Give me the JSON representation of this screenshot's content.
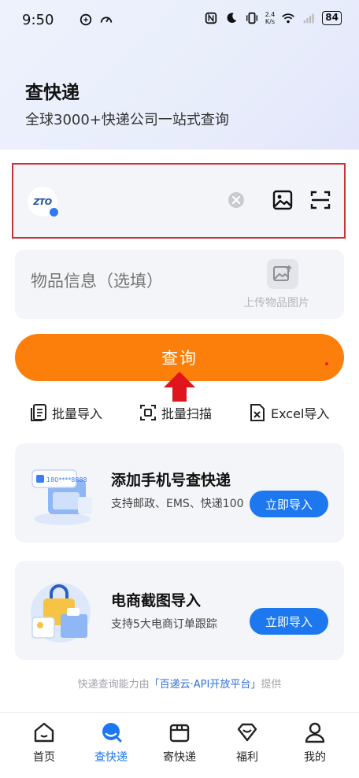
{
  "status_bar": {
    "time": "9:50",
    "net_speed_top": "2.4",
    "net_speed_bottom": "K/s",
    "battery": "84"
  },
  "header": {
    "title": "查快递",
    "subtitle": "全球3000+快递公司一站式查询"
  },
  "tracking": {
    "carrier_logo_text": "ZTO"
  },
  "item_info": {
    "placeholder": "物品信息（选填）",
    "upload_label": "上传物品图片"
  },
  "query_button": {
    "label": "查询"
  },
  "actions": [
    {
      "label": "批量导入"
    },
    {
      "label": "批量扫描"
    },
    {
      "label": "Excel导入"
    }
  ],
  "cards": [
    {
      "title": "添加手机号查快递",
      "desc": "支持邮政、EMS、快递100",
      "button": "立即导入",
      "illus_text": "180****8888"
    },
    {
      "title": "电商截图导入",
      "desc": "支持5大电商订单跟踪",
      "button": "立即导入"
    }
  ],
  "footer": {
    "prefix": "快递查询能力由",
    "highlight": "「百递云·API开放平台」",
    "suffix": "提供"
  },
  "tabs": [
    {
      "label": "首页",
      "active": false
    },
    {
      "label": "查快递",
      "active": true
    },
    {
      "label": "寄快递",
      "active": false
    },
    {
      "label": "福利",
      "active": false
    },
    {
      "label": "我的",
      "active": false
    }
  ],
  "colors": {
    "accent_orange": "#fd7f0b",
    "accent_blue": "#1d78f0",
    "highlight_red": "#c8323a"
  }
}
